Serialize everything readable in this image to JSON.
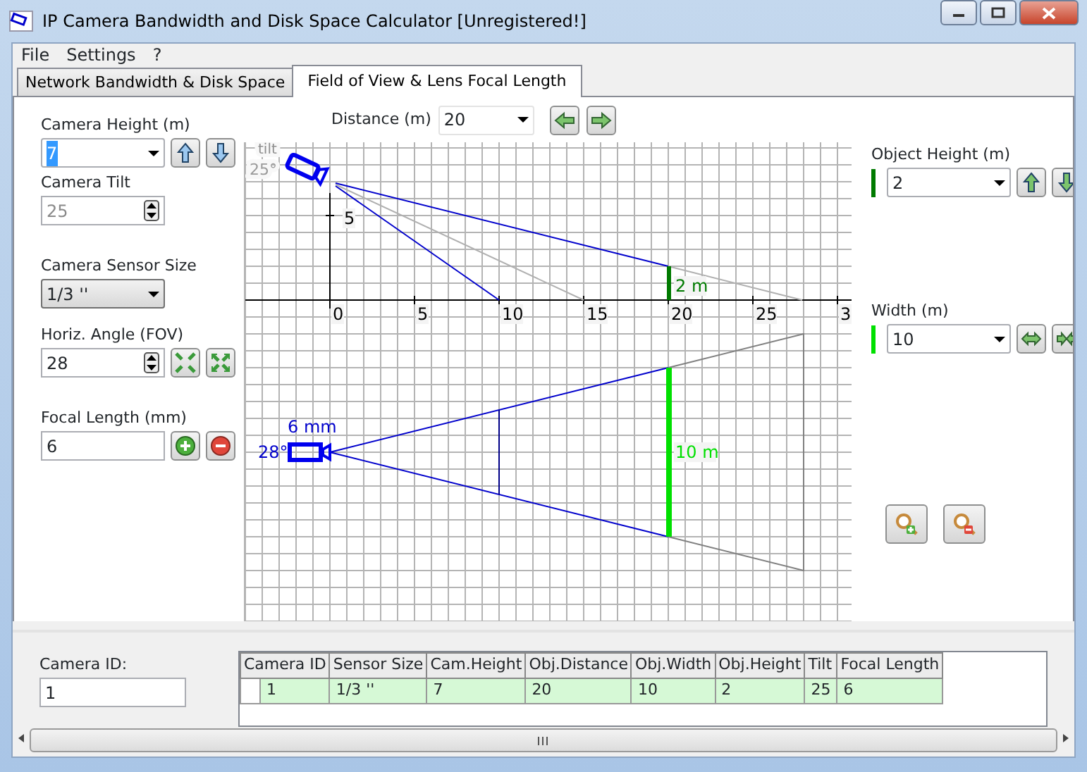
{
  "window": {
    "title": "IP Camera Bandwidth and Disk Space Calculator [Unregistered!]"
  },
  "menu": [
    "File",
    "Settings",
    "?"
  ],
  "tabs": [
    {
      "label": "Network Bandwidth & Disk Space",
      "selected": false
    },
    {
      "label": "Field of View & Lens Focal Length",
      "selected": true
    }
  ],
  "camera_height": {
    "label": "Camera Height (m)",
    "value": "7"
  },
  "camera_tilt": {
    "label": "Camera Tilt",
    "value": "25",
    "disabled": true
  },
  "sensor_size": {
    "label": "Camera Sensor Size",
    "value": "1/3 ''"
  },
  "horiz_angle": {
    "label": "Horiz. Angle (FOV)",
    "value": "28"
  },
  "focal_length": {
    "label": "Focal Length (mm)",
    "value": "6"
  },
  "distance": {
    "label": "Distance (m)",
    "value": "20"
  },
  "diagram": {
    "tilt_label": "tilt",
    "tilt_value": "25°",
    "y_tick": "5",
    "x_ticks": [
      "0",
      "5",
      "10",
      "15",
      "20",
      "25",
      "3"
    ],
    "object_height_label": "2 m",
    "width_label": "10 m",
    "focal_label": "6 mm",
    "angle_label": "28°"
  },
  "object_height": {
    "label": "Object Height (m)",
    "value": "2",
    "color": "#007a00"
  },
  "width": {
    "label": "Width (m)",
    "value": "10",
    "color": "#00e000"
  },
  "camera_id": {
    "label": "Camera ID:",
    "value": "1"
  },
  "table": {
    "columns": [
      "Camera ID",
      "Sensor Size",
      "Cam.Height",
      "Obj.Distance",
      "Obj.Width",
      "Obj.Height",
      "Tilt",
      "Focal Length"
    ],
    "rows": [
      {
        "cells": [
          "1",
          "1/3 ''",
          "7",
          "20",
          "10",
          "2",
          "25",
          "6"
        ],
        "selected": true
      }
    ]
  }
}
